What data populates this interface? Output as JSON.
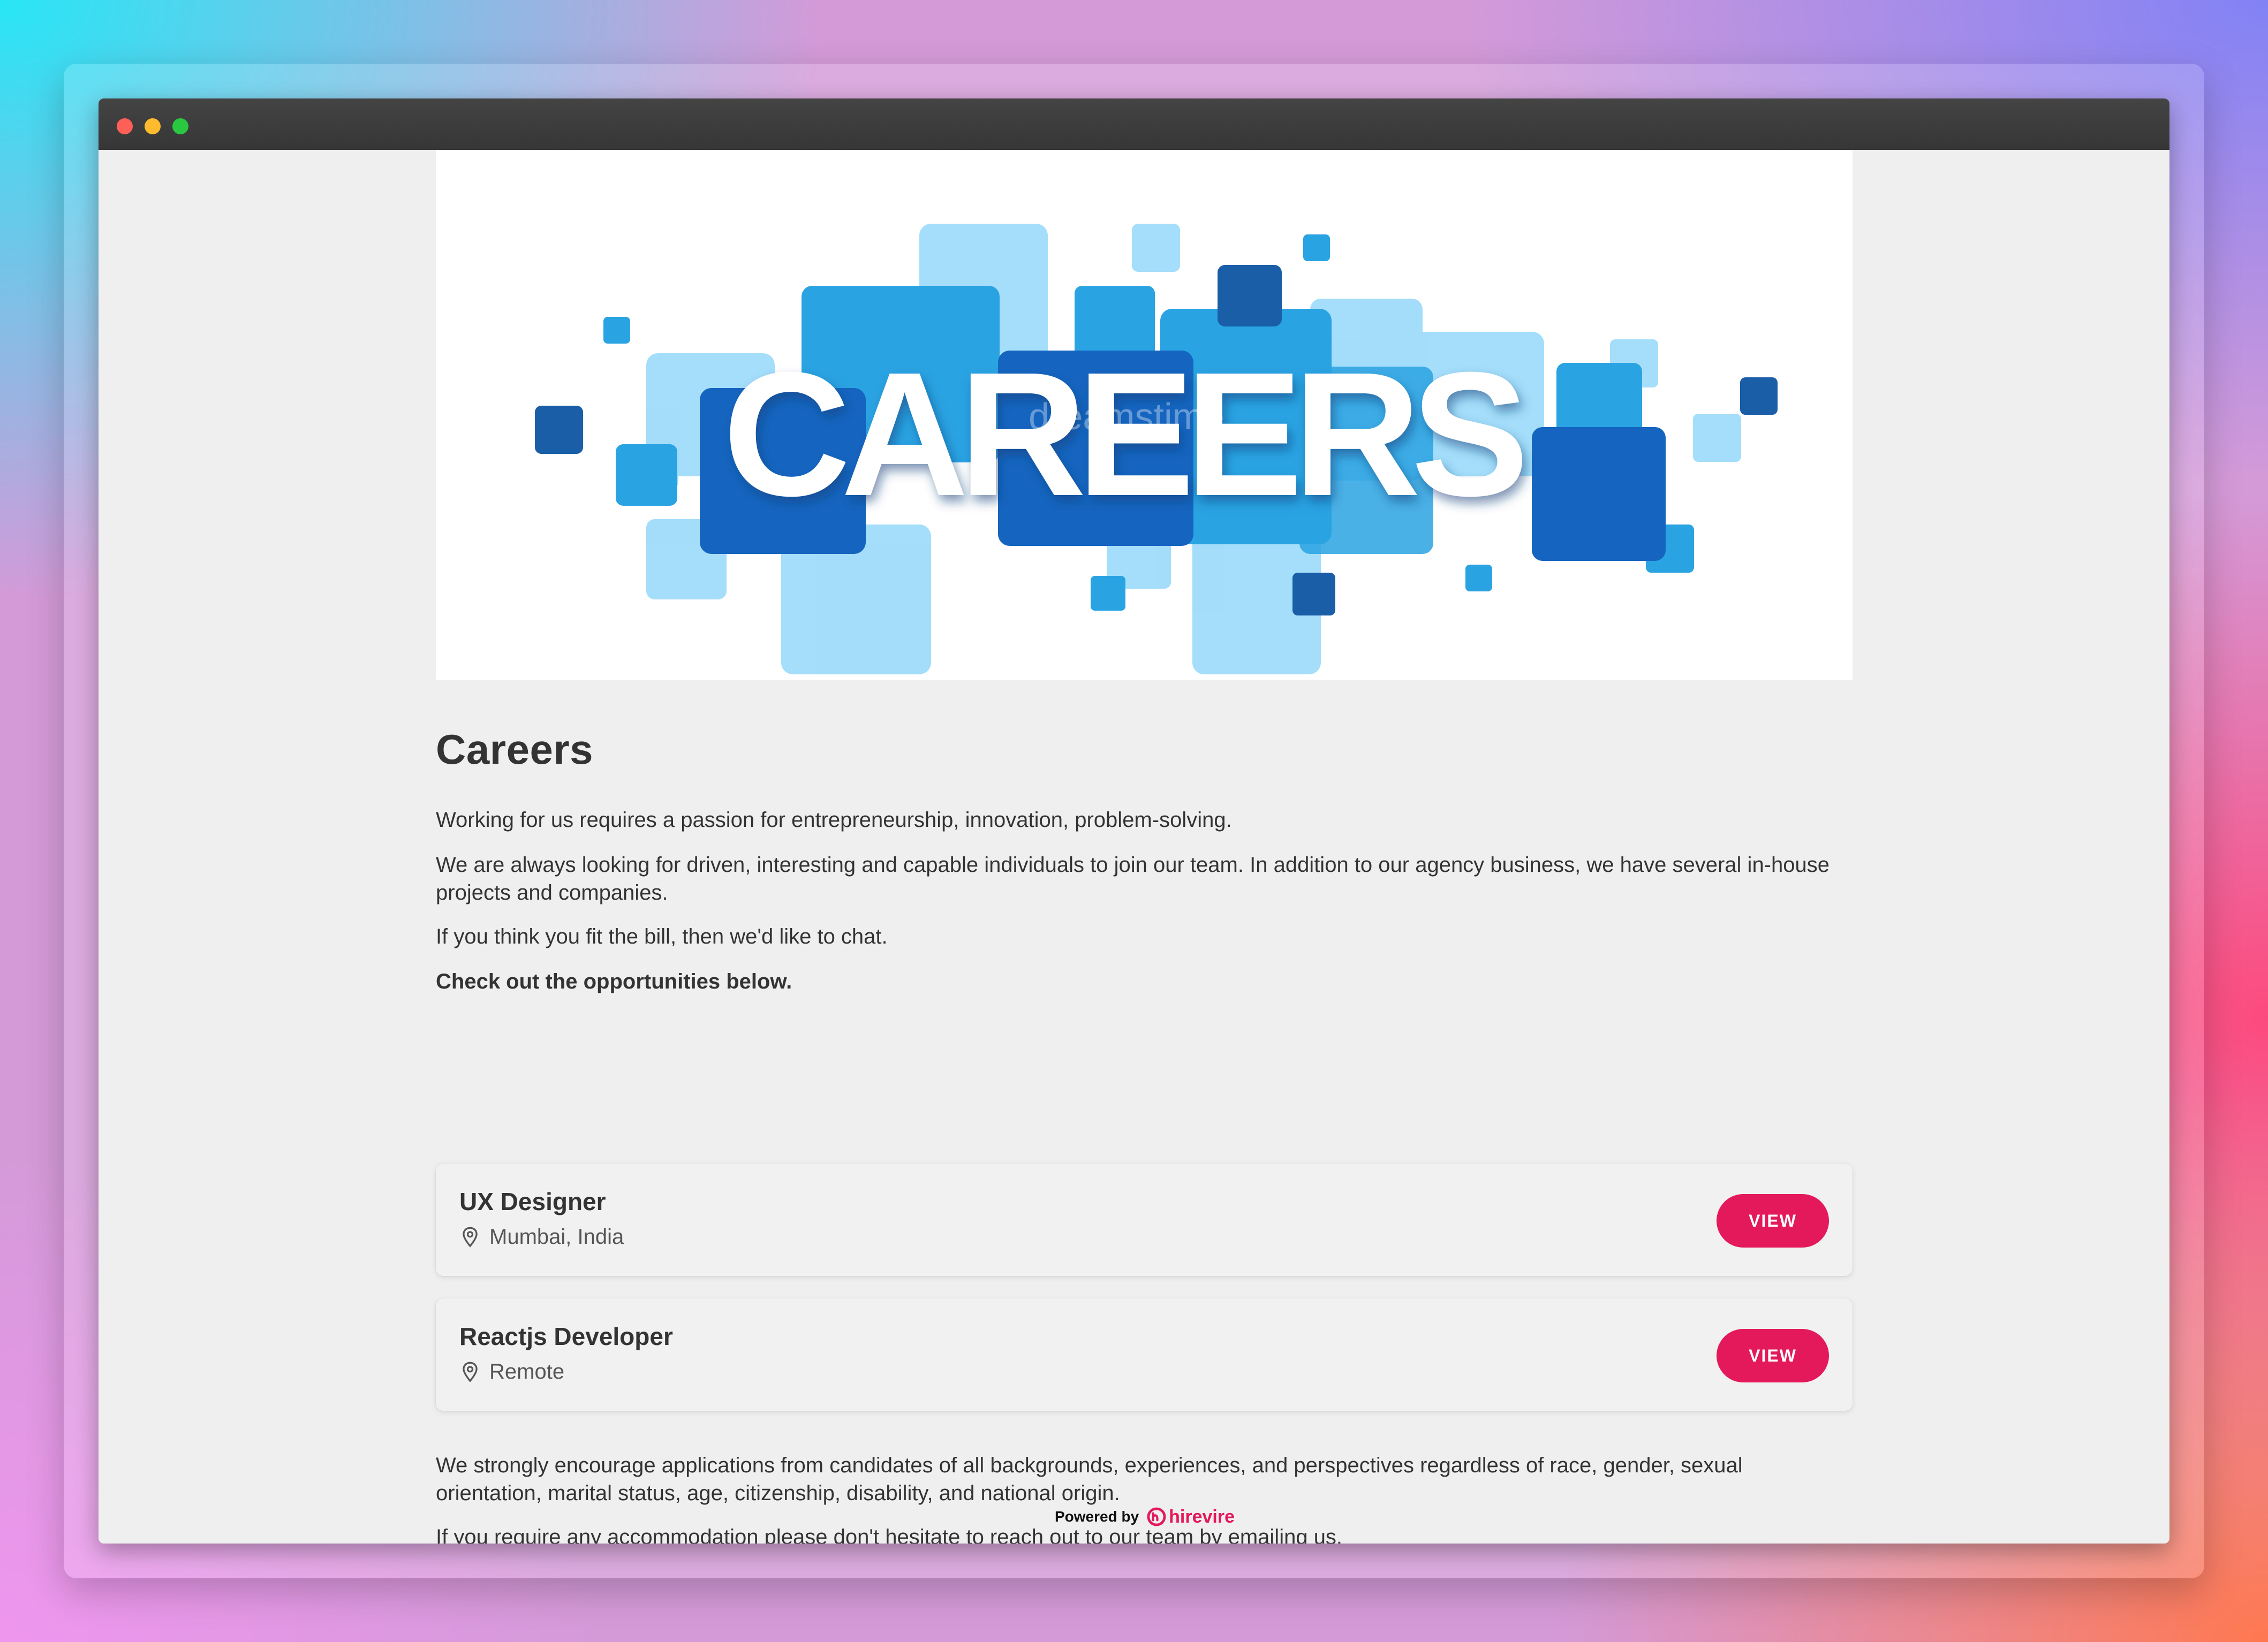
{
  "hero": {
    "banner_text": "CAREERS",
    "watermark": "dreamstime"
  },
  "page": {
    "title": "Careers",
    "intro": [
      "Working for us requires a passion for entrepreneurship, innovation, problem-solving.",
      "We are always looking for driven, interesting and capable individuals to join our team. In addition to our agency business, we have several in-house projects and companies.",
      "If you think you fit the bill, then we'd like to chat.",
      "Check out the opportunities below."
    ],
    "outro": [
      "We strongly encourage applications from candidates of all backgrounds, experiences, and perspectives regardless of race, gender, sexual orientation, marital status, age, citizenship, disability, and national origin.",
      "If you require any accommodation please don't hesitate to reach out to our team by emailing us."
    ]
  },
  "jobs": [
    {
      "title": "UX Designer",
      "location": "Mumbai, India",
      "button": "VIEW"
    },
    {
      "title": "Reactjs Developer",
      "location": "Remote",
      "button": "VIEW"
    }
  ],
  "footer": {
    "powered_by": "Powered by",
    "brand": "hirevire",
    "brand_color": "#e3195b"
  },
  "colors": {
    "accent": "#e3195b",
    "titlebar": "#3a3a3a",
    "page_bg": "#efefef"
  }
}
